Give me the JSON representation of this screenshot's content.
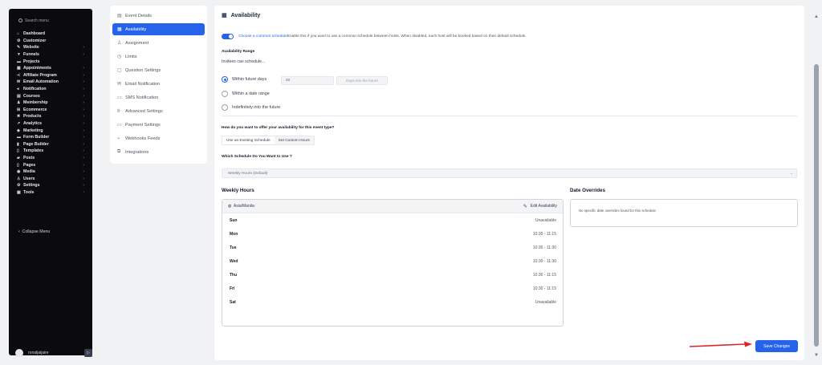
{
  "sidebar": {
    "search_placeholder": "Search menu",
    "items": [
      {
        "icon": "dashboard-icon",
        "glyph": "⌂",
        "label": "Dashboard",
        "has_children": false
      },
      {
        "icon": "customizer-icon",
        "glyph": "⚙",
        "label": "Customizer",
        "has_children": false
      },
      {
        "icon": "website-icon",
        "glyph": "✎",
        "label": "Website",
        "has_children": true
      },
      {
        "icon": "funnels-icon",
        "glyph": "▼",
        "label": "Funnels",
        "has_children": true
      },
      {
        "icon": "projects-icon",
        "glyph": "▬",
        "label": "Projects",
        "has_children": false
      },
      {
        "icon": "appointments-icon",
        "glyph": "▦",
        "label": "Appointments",
        "has_children": true
      },
      {
        "icon": "affiliate-icon",
        "glyph": "≺",
        "label": "Affiliate Program",
        "has_children": true
      },
      {
        "icon": "email-icon",
        "glyph": "✉",
        "label": "Email Automation",
        "has_children": true
      },
      {
        "icon": "notification-icon",
        "glyph": "◂",
        "label": "Notification",
        "has_children": true
      },
      {
        "icon": "courses-icon",
        "glyph": "▤",
        "label": "Courses",
        "has_children": true
      },
      {
        "icon": "membership-icon",
        "glyph": "♟",
        "label": "Membership",
        "has_children": true
      },
      {
        "icon": "ecommerce-icon",
        "glyph": "⊞",
        "label": "Ecommerce",
        "has_children": true
      },
      {
        "icon": "products-icon",
        "glyph": "✖",
        "label": "Products",
        "has_children": true
      },
      {
        "icon": "analytics-icon",
        "glyph": "↗",
        "label": "Analytics",
        "has_children": true
      },
      {
        "icon": "marketing-icon",
        "glyph": "◆",
        "label": "Marketing",
        "has_children": true
      },
      {
        "icon": "form-builder-icon",
        "glyph": "▬",
        "label": "Form Builder",
        "has_children": true
      },
      {
        "icon": "page-builder-icon",
        "glyph": "▮",
        "label": "Page Builder",
        "has_children": true
      },
      {
        "icon": "templates-icon",
        "glyph": "▯",
        "label": "Templates",
        "has_children": true
      },
      {
        "icon": "posts-icon",
        "glyph": "▰",
        "label": "Posts",
        "has_children": true
      },
      {
        "icon": "pages-icon",
        "glyph": "▯",
        "label": "Pages",
        "has_children": true
      },
      {
        "icon": "media-icon",
        "glyph": "◉",
        "label": "Media",
        "has_children": true
      },
      {
        "icon": "users-icon",
        "glyph": "♙",
        "label": "Users",
        "has_children": true
      },
      {
        "icon": "settings-icon",
        "glyph": "⚙",
        "label": "Settings",
        "has_children": true
      },
      {
        "icon": "tools-icon",
        "glyph": "▦",
        "label": "Tools",
        "has_children": true
      }
    ],
    "collapse_label": "Collapse Menu",
    "collapse_glyph": "‹",
    "user_name": "ronaljaijaire",
    "user_action_glyph": "▷"
  },
  "submenu": {
    "items": [
      {
        "icon": "event-details-icon",
        "glyph": "▤",
        "label": "Event Details",
        "active": false
      },
      {
        "icon": "availability-icon",
        "glyph": "▦",
        "label": "Availability",
        "active": true
      },
      {
        "icon": "assignment-icon",
        "glyph": "♙",
        "label": "Assignment",
        "active": false
      },
      {
        "icon": "limits-icon",
        "glyph": "◷",
        "label": "Limits",
        "active": false
      },
      {
        "icon": "question-settings-icon",
        "glyph": "▢",
        "label": "Question Settings",
        "active": false
      },
      {
        "icon": "email-notification-icon",
        "glyph": "✉",
        "label": "Email Notification",
        "active": false
      },
      {
        "icon": "sms-notification-icon",
        "glyph": "▭",
        "label": "SMS Notification",
        "active": false
      },
      {
        "icon": "advanced-settings-icon",
        "glyph": "⊪",
        "label": "Advanced Settings",
        "active": false
      },
      {
        "icon": "payment-settings-icon",
        "glyph": "▭",
        "label": "Payment Settings",
        "active": false
      },
      {
        "icon": "webhooks-icon",
        "glyph": "⌁",
        "label": "Webhooks Feeds",
        "active": false
      },
      {
        "icon": "integrations-icon",
        "glyph": "⧉",
        "label": "Integrations",
        "active": false
      }
    ]
  },
  "main": {
    "title": "Availability",
    "title_glyph": "▦",
    "toggle": {
      "on": true,
      "link_text": "Choose a common schedule",
      "rest_text": "Enable this if you want to use a common schedule between hosts. When disabled, each host will be booked based on their default schedule."
    },
    "range_label": "Availability Range",
    "invitees_text": "Invitees can schedule...",
    "radios": [
      {
        "label": "Within future days",
        "checked": true
      },
      {
        "label": "Within a date range",
        "checked": false
      },
      {
        "label": "Indefinitely into the future",
        "checked": false
      }
    ],
    "days_value": "60",
    "days_suffix": "Days into the future",
    "offer_question": "How do you want to offer your availability for this event type?",
    "offer_options": [
      "Use an Existing Schedule",
      "Set Custom Hours"
    ],
    "offer_selected": 0,
    "schedule_question": "Which Schedule Do You Want to Use ?",
    "schedule_value": "Weekly Hours (Default)",
    "weekly_title": "Weekly Hours",
    "timezone": "Asia/Manila",
    "edit_label": "Edit Availability",
    "days": [
      {
        "day": "Sun",
        "time": "Unavailable"
      },
      {
        "day": "Mon",
        "time": "10:30 - 11:15"
      },
      {
        "day": "Tue",
        "time": "10:30 - 11:30"
      },
      {
        "day": "Wed",
        "time": "10:30 - 11:30"
      },
      {
        "day": "Thu",
        "time": "10:30 - 11:15"
      },
      {
        "day": "Fri",
        "time": "10:30 - 11:15"
      },
      {
        "day": "Sat",
        "time": "Unavailable"
      }
    ],
    "overrides_title": "Date Overrides",
    "overrides_empty": "No specific date overrides found for this schedule",
    "save_label": "Save Changes",
    "accent": "#2563eb",
    "arrow_color": "#dc2626"
  }
}
